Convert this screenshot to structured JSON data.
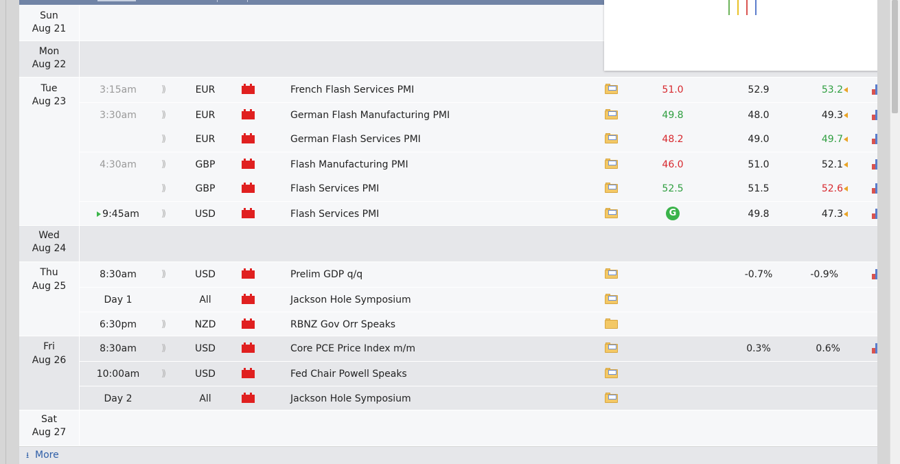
{
  "calendar": {
    "days": {
      "sun": {
        "weekday": "Sun",
        "date": "Aug 21"
      },
      "mon": {
        "weekday": "Mon",
        "date": "Aug 22"
      },
      "tue": {
        "weekday": "Tue",
        "date": "Aug 23"
      },
      "wed": {
        "weekday": "Wed",
        "date": "Aug 24"
      },
      "thu": {
        "weekday": "Thu",
        "date": "Aug 25"
      },
      "fri": {
        "weekday": "Fri",
        "date": "Aug 26"
      },
      "sat": {
        "weekday": "Sat",
        "date": "Aug 27"
      }
    },
    "events": [
      {
        "time": "3:15am",
        "currency": "EUR",
        "event": "French Flash Services PMI",
        "actual": "51.0",
        "actual_color": "red",
        "forecast": "52.9",
        "previous": "53.2",
        "previous_color": "green"
      },
      {
        "time": "3:30am",
        "currency": "EUR",
        "event": "German Flash Manufacturing PMI",
        "actual": "49.8",
        "actual_color": "green",
        "forecast": "48.0",
        "previous": "49.3",
        "previous_color": "default"
      },
      {
        "time": "",
        "currency": "EUR",
        "event": "German Flash Services PMI",
        "actual": "48.2",
        "actual_color": "red",
        "forecast": "49.0",
        "previous": "49.7",
        "previous_color": "green"
      },
      {
        "time": "4:30am",
        "currency": "GBP",
        "event": "Flash Manufacturing PMI",
        "actual": "46.0",
        "actual_color": "red",
        "forecast": "51.0",
        "previous": "52.1",
        "previous_color": "default"
      },
      {
        "time": "",
        "currency": "GBP",
        "event": "Flash Services PMI",
        "actual": "52.5",
        "actual_color": "green",
        "forecast": "51.5",
        "previous": "52.6",
        "previous_color": "red"
      },
      {
        "time": "9:45am",
        "currency": "USD",
        "event": "Flash Services PMI",
        "actual": "",
        "actual_icon": "refresh-icon",
        "forecast": "49.8",
        "previous": "47.3",
        "previous_color": "default"
      },
      {
        "time": "8:30am",
        "currency": "USD",
        "event": "Prelim GDP q/q",
        "actual": "",
        "forecast": "-0.7%",
        "previous": "-0.9%",
        "previous_color": "default"
      },
      {
        "time": "Day 1",
        "currency": "All",
        "event": "Jackson Hole Symposium",
        "actual": "",
        "forecast": "",
        "previous": ""
      },
      {
        "time": "6:30pm",
        "currency": "NZD",
        "event": "RBNZ Gov Orr Speaks",
        "actual": "",
        "forecast": "",
        "previous": ""
      },
      {
        "time": "8:30am",
        "currency": "USD",
        "event": "Core PCE Price Index m/m",
        "actual": "",
        "forecast": "0.3%",
        "previous": "0.6%",
        "previous_color": "default"
      },
      {
        "time": "10:00am",
        "currency": "USD",
        "event": "Fed Chair Powell Speaks",
        "actual": "",
        "forecast": "",
        "previous": ""
      },
      {
        "time": "Day 2",
        "currency": "All",
        "event": "Jackson Hole Symposium",
        "actual": "",
        "forecast": "",
        "previous": ""
      }
    ],
    "refresh_glyph": "G",
    "sound_glyph": "))",
    "more_label": "More",
    "more_icon": "download-arrow-icon",
    "colors": {
      "green": "#2e9e3f",
      "red": "#d7282e",
      "impact_high": "#e02020",
      "revised_arrow": "#e9a427",
      "link": "#2e5ea7"
    }
  }
}
